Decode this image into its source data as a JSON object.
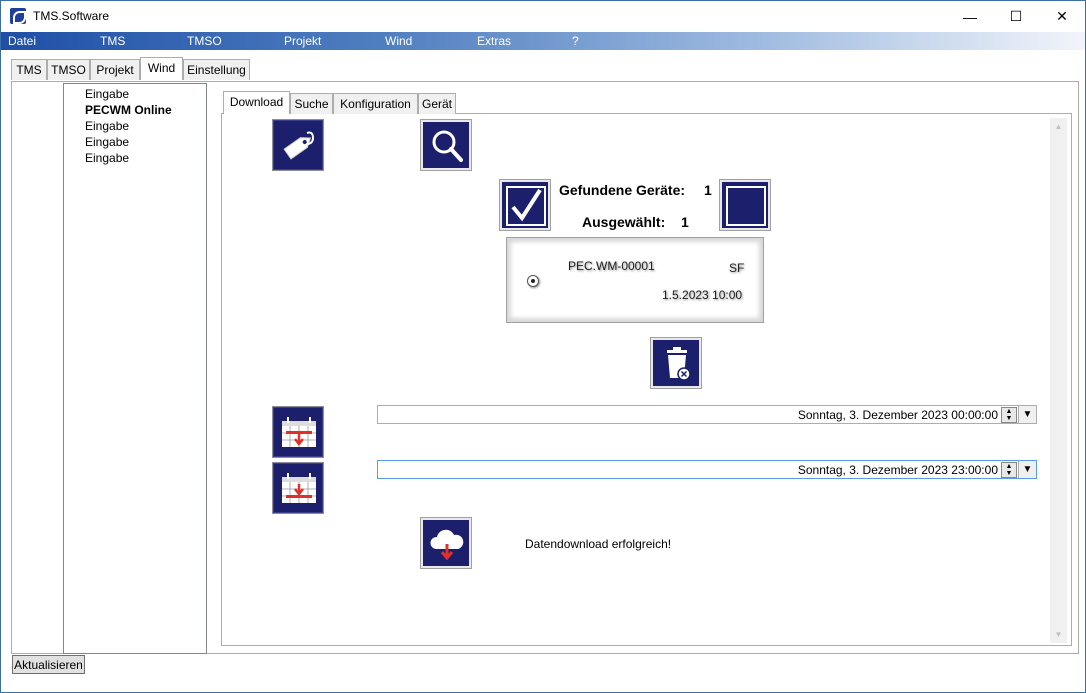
{
  "window": {
    "title": "TMS.Software",
    "minimize": "—",
    "maximize": "☐",
    "close": "✕"
  },
  "menu": [
    "Datei",
    "TMS",
    "TMSO",
    "Projekt",
    "Wind",
    "Extras",
    "?"
  ],
  "outer_tabs": [
    "TMS",
    "TMSO",
    "Projekt",
    "Wind",
    "Einstellung"
  ],
  "outer_active_tab": "Wind",
  "tree": {
    "items": [
      {
        "label": "Eingabe",
        "bold": false
      },
      {
        "label": "PECWM Online",
        "bold": true
      },
      {
        "label": "Eingabe",
        "bold": false
      },
      {
        "label": "Eingabe",
        "bold": false
      },
      {
        "label": "Eingabe",
        "bold": false
      }
    ]
  },
  "inner_tabs": [
    "Download",
    "Suche",
    "Konfiguration",
    "Gerät"
  ],
  "inner_active_tab": "Download",
  "devices": {
    "found_label": "Gefundene Geräte:",
    "found_count": "1",
    "selected_label": "Ausgewählt:",
    "selected_count": "1",
    "list": [
      {
        "id": "PEC.WM-00001",
        "code": "SF",
        "date": "1.5.2023 10:00"
      }
    ]
  },
  "range": {
    "start": "Sonntag, 3. Dezember 2023 00:00:00",
    "end": "Sonntag, 3. Dezember 2023 23:00:00"
  },
  "status": "Datendownload erfolgreich!",
  "refresh_button": "Aktualisieren",
  "colors": {
    "icon_bg": "#1c1f6b",
    "menu_start": "#1e4fa6",
    "accent_red": "#e0302a"
  },
  "icons": [
    "tag-icon",
    "search-icon",
    "check-all-icon",
    "uncheck-all-icon",
    "delete-icon",
    "calendar-start-icon",
    "calendar-end-icon",
    "cloud-download-icon"
  ]
}
